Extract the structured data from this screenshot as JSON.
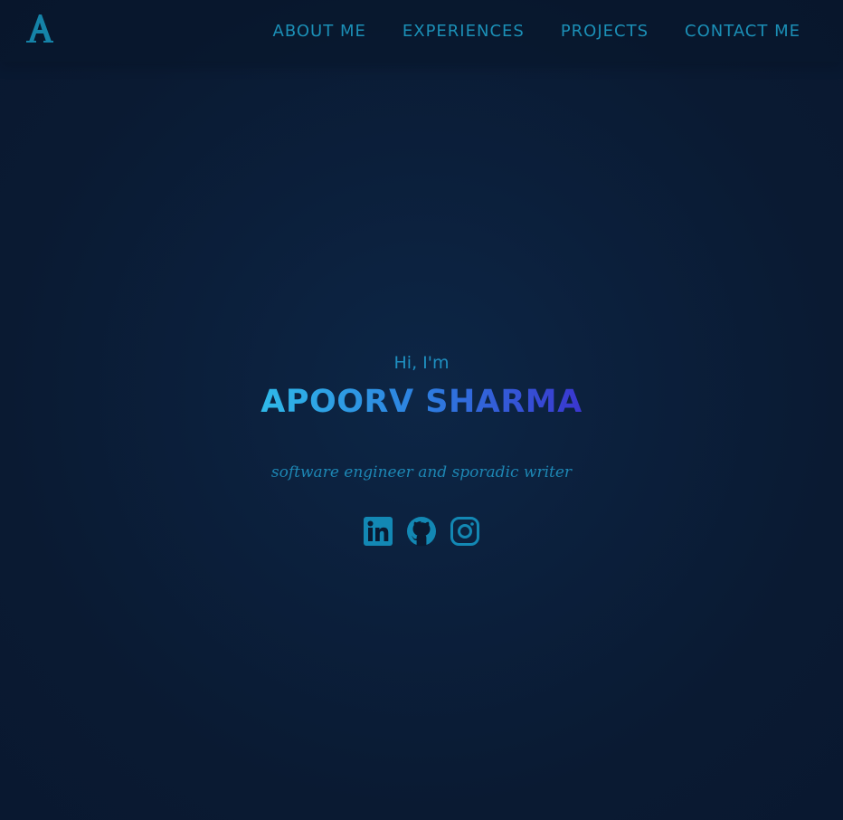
{
  "header": {
    "logo_letter": "A",
    "logo_icon": "a-letter-logo",
    "nav": [
      {
        "label": "ABOUT ME"
      },
      {
        "label": "EXPERIENCES"
      },
      {
        "label": "PROJECTS"
      },
      {
        "label": "CONTACT ME"
      }
    ]
  },
  "hero": {
    "greeting": "Hi, I'm",
    "name": "APOORV SHARMA",
    "tagline": "software engineer and sporadic writer",
    "socials": [
      {
        "icon": "linkedin-icon"
      },
      {
        "icon": "github-icon"
      },
      {
        "icon": "instagram-icon"
      }
    ]
  },
  "colors": {
    "background": "#0a1a32",
    "accent": "#1b8fb6",
    "name_gradient_start": "#2fb9e8",
    "name_gradient_end": "#3a36cf"
  }
}
